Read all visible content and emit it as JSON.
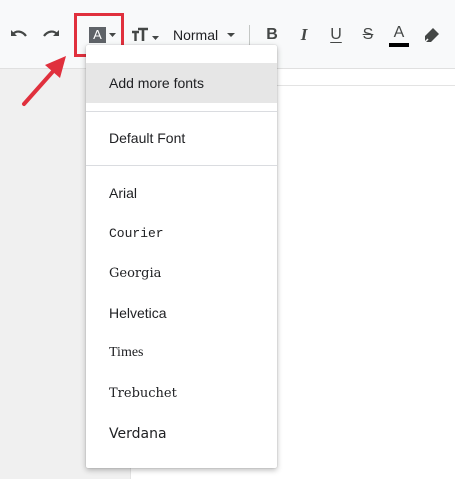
{
  "toolbar": {
    "undo_icon": "undo-icon",
    "redo_icon": "redo-icon",
    "font_button_letter": "A",
    "text_size_icon": "text-size-icon",
    "style_select_value": "Normal",
    "bold_label": "B",
    "italic_label": "I",
    "underline_label": "U",
    "strike_label": "S",
    "text_color_letter": "A",
    "text_color_bar": "#000000",
    "highlight_icon": "highlighter-icon"
  },
  "font_menu": {
    "add_more": "Add more fonts",
    "default_font": "Default Font",
    "fonts": [
      {
        "label": "Arial"
      },
      {
        "label": "Courier"
      },
      {
        "label": "Georgia"
      },
      {
        "label": "Helvetica"
      },
      {
        "label": "Times"
      },
      {
        "label": "Trebuchet"
      },
      {
        "label": "Verdana"
      }
    ]
  },
  "annotation": {
    "highlight_color": "#e0303d"
  }
}
